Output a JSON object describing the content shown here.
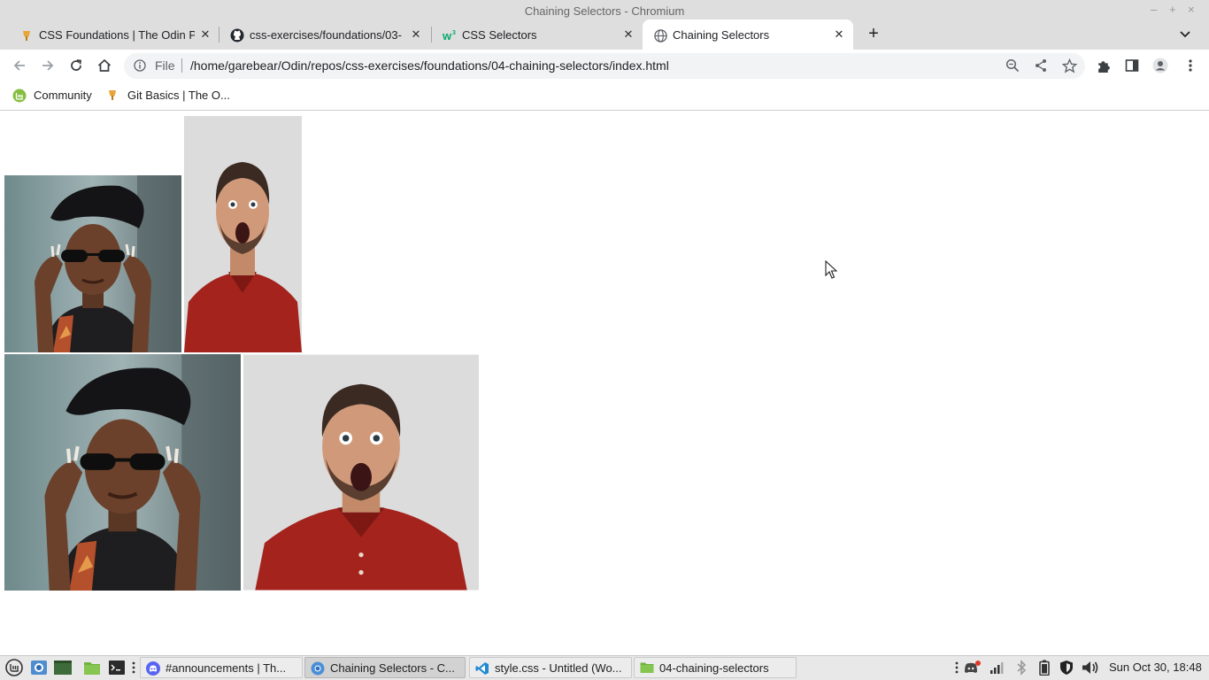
{
  "window": {
    "title": "Chaining Selectors - Chromium",
    "controls": [
      "–",
      "+",
      "×"
    ]
  },
  "tabs": [
    {
      "label": "CSS Foundations | The Odin Pr",
      "favicon": "odin-project-icon",
      "active": false
    },
    {
      "label": "css-exercises/foundations/03-",
      "favicon": "github-icon",
      "active": false
    },
    {
      "label": "CSS Selectors",
      "favicon": "w3schools-icon",
      "active": false
    },
    {
      "label": "Chaining Selectors",
      "favicon": "globe-icon",
      "active": true
    }
  ],
  "toolbar": {
    "scheme_chip": "File",
    "url": "/home/garebear/Odin/repos/css-exercises/foundations/04-chaining-selectors/index.html"
  },
  "bookmarks": [
    {
      "label": "Community",
      "favicon": "linux-mint-icon"
    },
    {
      "label": "Git Basics | The O...",
      "favicon": "odin-project-icon"
    }
  ],
  "page": {
    "images": [
      {
        "name": "woman-with-sunglasses-photo",
        "subject": "woman in beret lowering sunglasses"
      },
      {
        "name": "surprised-man-photo",
        "subject": "surprised man in red polo shirt"
      },
      {
        "name": "woman-with-sunglasses-photo-large",
        "subject": "woman in beret lowering sunglasses"
      },
      {
        "name": "surprised-man-photo-large",
        "subject": "surprised man in red polo shirt"
      }
    ]
  },
  "taskbar": {
    "tasks": [
      {
        "label": "#announcements | Th...",
        "icon": "discord-icon",
        "active": false
      },
      {
        "label": "Chaining Selectors - C...",
        "icon": "chromium-icon",
        "active": true
      },
      {
        "label": "style.css - Untitled (Wo...",
        "icon": "vscode-icon",
        "active": false
      },
      {
        "label": "04-chaining-selectors",
        "icon": "folder-icon",
        "active": false
      }
    ],
    "clock": "Sun Oct 30, 18:48"
  },
  "colors": {
    "chrome_bg": "#dedede",
    "omnibox_bg": "#f1f3f4",
    "taskbar_bg": "#e8e8e8",
    "red_shirt": "#a5231d"
  }
}
